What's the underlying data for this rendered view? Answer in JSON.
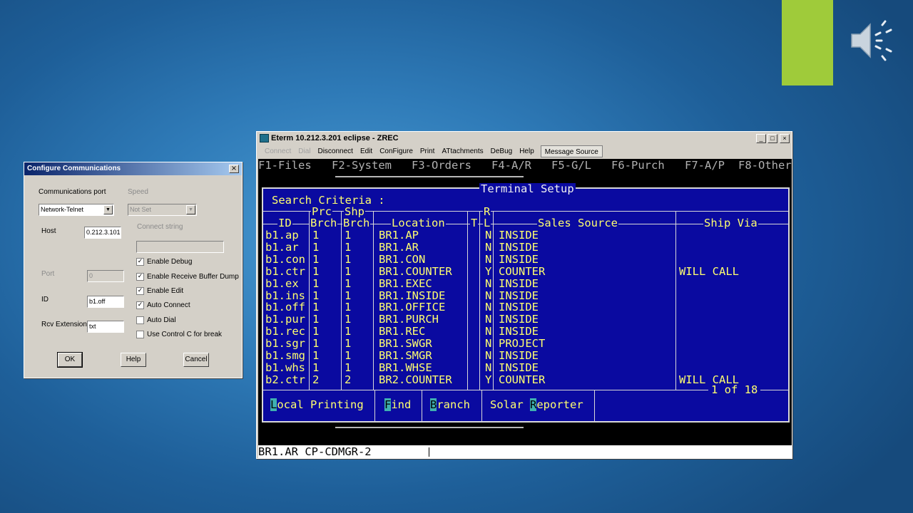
{
  "config": {
    "title": "Configure Communications",
    "close": "×",
    "comm_port_label": "Communications port",
    "comm_port_value": "Network-Telnet",
    "speed_label": "Speed",
    "speed_value": "Not Set",
    "host_label": "Host",
    "host_value": "0.212.3.101",
    "connect_string_label": "Connect string",
    "connect_string_value": "",
    "port_label": "Port",
    "port_value": "0",
    "id_label": "ID",
    "id_value": "b1.off",
    "rcv_ext_label": "Rcv Extension",
    "rcv_ext_value": "txt",
    "checkboxes": [
      {
        "label": "Enable Debug",
        "checked": true,
        "mark": "✓"
      },
      {
        "label": "Enable Receive Buffer Dump",
        "checked": true,
        "mark": "✓"
      },
      {
        "label": "Enable Edit",
        "checked": true,
        "mark": "✓"
      },
      {
        "label": "Auto Connect",
        "checked": true,
        "mark": "✓"
      },
      {
        "label": "Auto Dial",
        "checked": false,
        "mark": ""
      },
      {
        "label": "Use Control C for break",
        "checked": false,
        "mark": ""
      }
    ],
    "ok_label": "OK",
    "help_label": "Help",
    "cancel_label": "Cancel"
  },
  "eterm": {
    "title": "Eterm 10.212.3.201 eclipse - ZREC",
    "window_buttons": {
      "minimize": "_",
      "maximize": "□",
      "close": "×"
    },
    "menu": [
      "Connect",
      "Dial",
      "Disconnect",
      "Edit",
      "ConFigure",
      "Print",
      "ATtachments",
      "DeBug",
      "Help",
      "Message Source"
    ],
    "fkeys": [
      "F1-Files",
      "F2-System",
      "F3-Orders",
      "F4-A/R",
      "F5-G/L",
      "F6-Purch",
      "F7-A/P",
      "F8-Other"
    ],
    "panel_title": "Terminal Setup",
    "search_criteria": "Search Criteria :",
    "headers": {
      "id": "ID",
      "prc_top": "Prc",
      "prc_bottom": "Brch",
      "shp_top": "Shp",
      "shp_bottom": "Brch",
      "location": "Location",
      "t": "T",
      "rl_top": "R",
      "rl_bottom": "L",
      "sales_source": "Sales Source",
      "ship_via": "Ship Via"
    },
    "rows": [
      {
        "id": "b1.ap",
        "prc": "1",
        "shp": "1",
        "loc": "BR1.AP",
        "rl": "N",
        "sales": "INSIDE",
        "ship": ""
      },
      {
        "id": "b1.ar",
        "prc": "1",
        "shp": "1",
        "loc": "BR1.AR",
        "rl": "N",
        "sales": "INSIDE",
        "ship": ""
      },
      {
        "id": "b1.con",
        "prc": "1",
        "shp": "1",
        "loc": "BR1.CON",
        "rl": "N",
        "sales": "INSIDE",
        "ship": ""
      },
      {
        "id": "b1.ctr",
        "prc": "1",
        "shp": "1",
        "loc": "BR1.COUNTER",
        "rl": "Y",
        "sales": "COUNTER",
        "ship": "WILL CALL"
      },
      {
        "id": "b1.ex",
        "prc": "1",
        "shp": "1",
        "loc": "BR1.EXEC",
        "rl": "N",
        "sales": "INSIDE",
        "ship": ""
      },
      {
        "id": "b1.ins",
        "prc": "1",
        "shp": "1",
        "loc": "BR1.INSIDE",
        "rl": "N",
        "sales": "INSIDE",
        "ship": ""
      },
      {
        "id": "b1.off",
        "prc": "1",
        "shp": "1",
        "loc": "BR1.OFFICE",
        "rl": "N",
        "sales": "INSIDE",
        "ship": ""
      },
      {
        "id": "b1.pur",
        "prc": "1",
        "shp": "1",
        "loc": "BR1.PURCH",
        "rl": "N",
        "sales": "INSIDE",
        "ship": ""
      },
      {
        "id": "b1.rec",
        "prc": "1",
        "shp": "1",
        "loc": "BR1.REC",
        "rl": "N",
        "sales": "INSIDE",
        "ship": ""
      },
      {
        "id": "b1.sgr",
        "prc": "1",
        "shp": "1",
        "loc": "BR1.SWGR",
        "rl": "N",
        "sales": "PROJECT",
        "ship": ""
      },
      {
        "id": "b1.smg",
        "prc": "1",
        "shp": "1",
        "loc": "BR1.SMGR",
        "rl": "N",
        "sales": "INSIDE",
        "ship": ""
      },
      {
        "id": "b1.whs",
        "prc": "1",
        "shp": "1",
        "loc": "BR1.WHSE",
        "rl": "N",
        "sales": "INSIDE",
        "ship": ""
      },
      {
        "id": "b2.ctr",
        "prc": "2",
        "shp": "2",
        "loc": "BR2.COUNTER",
        "rl": "Y",
        "sales": "COUNTER",
        "ship": "WILL CALL"
      }
    ],
    "pager": "1 of 18",
    "buttons": [
      {
        "hotkey": "L",
        "rest": "ocal Printing"
      },
      {
        "hotkey": "F",
        "rest": "ind"
      },
      {
        "hotkey": "B",
        "rest": "ranch"
      },
      {
        "pre": "Solar ",
        "hotkey": "R",
        "rest": "eporter"
      }
    ],
    "status_line": "BR1.AR CP-CDMGR-2"
  },
  "colors": {
    "accent_green": "#9fcb3a",
    "terminal_blue": "#0a0aa0",
    "terminal_text": "#ffff70",
    "hotkey_bg": "#3fb0b0"
  },
  "icons": {
    "speaker": "speaker-icon"
  }
}
